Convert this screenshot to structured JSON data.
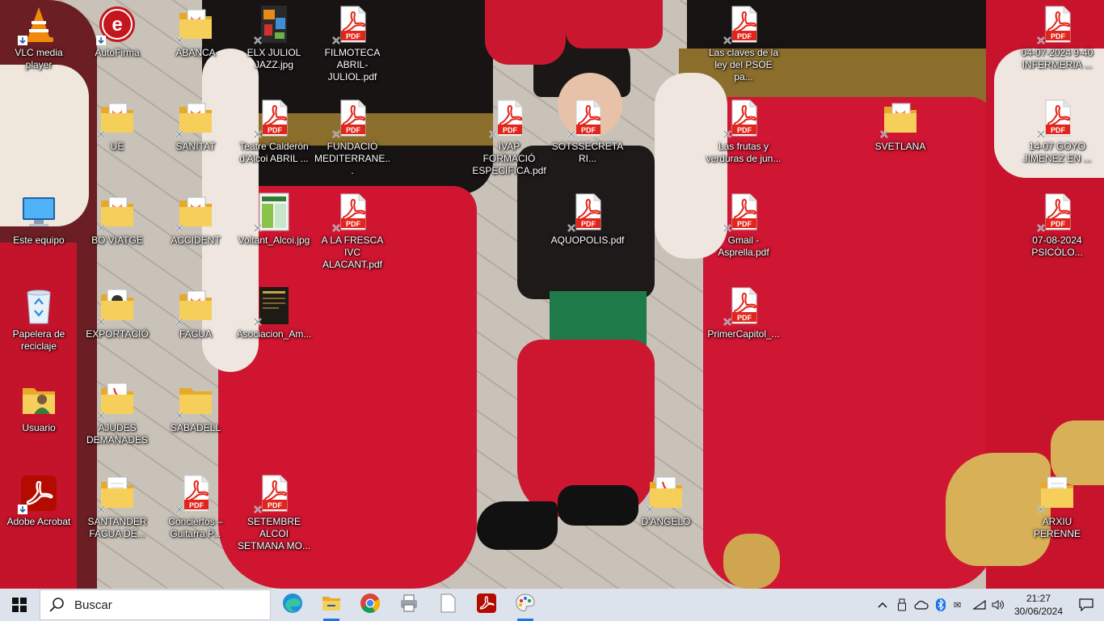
{
  "desktop": {
    "icons": [
      {
        "id": "vlc",
        "label": "VLC media player",
        "type": "vlc",
        "badge": "shortcut"
      },
      {
        "id": "autofirma",
        "label": "AutoFirma",
        "type": "autofirma",
        "badge": "shortcut"
      },
      {
        "id": "abanca",
        "label": "ABANCA",
        "type": "folder-doc",
        "badge": "x"
      },
      {
        "id": "elx",
        "label": "ELX JULIOL JAZZ.jpg",
        "type": "jpg-poster",
        "badge": "x"
      },
      {
        "id": "filmoteca",
        "label": "FILMOTECA ABRIL-JULIOL.pdf",
        "type": "pdf",
        "badge": "x"
      },
      {
        "id": "claves",
        "label": "Las claves de la ley del PSOE pa...",
        "type": "pdf",
        "badge": "x"
      },
      {
        "id": "infermeria",
        "label": "04-07-2024 9-40 INFERMERIA ...",
        "type": "pdf",
        "badge": "x"
      },
      {
        "id": "ue",
        "label": "UE",
        "type": "folder-doc",
        "badge": "x"
      },
      {
        "id": "sanitat",
        "label": "SANITAT",
        "type": "folder-doc",
        "badge": "x"
      },
      {
        "id": "teatre",
        "label": "Teatre Calderón d'Alcoi ABRIL ...",
        "type": "pdf",
        "badge": "x"
      },
      {
        "id": "fundacio",
        "label": "FUNDACIÓ MEDITERRANE...",
        "type": "pdf",
        "badge": "x"
      },
      {
        "id": "ivap",
        "label": "IVAP FORMACIÓ ESPECÍFICA.pdf",
        "type": "pdf",
        "badge": "x"
      },
      {
        "id": "sotssecretari",
        "label": "SOTSSECRETARI...",
        "type": "pdf",
        "badge": "x"
      },
      {
        "id": "frutas",
        "label": "Las frutas y verduras de jun...",
        "type": "pdf",
        "badge": "x"
      },
      {
        "id": "svetlana",
        "label": "SVETLANA",
        "type": "folder-doc",
        "badge": "x"
      },
      {
        "id": "goyo",
        "label": "14-07 GOYO JIMENEZ EN ...",
        "type": "pdf",
        "badge": "x"
      },
      {
        "id": "esteequipo",
        "label": "Este equipo",
        "type": "computer",
        "badge": "none"
      },
      {
        "id": "boviatge",
        "label": "BO VIATGE",
        "type": "folder-doc",
        "badge": "x"
      },
      {
        "id": "accident",
        "label": "ACCIDENT",
        "type": "folder-doc",
        "badge": "x"
      },
      {
        "id": "voltant",
        "label": "Voltant_Alcoi.jpg",
        "type": "jpg-map",
        "badge": "x"
      },
      {
        "id": "fresca",
        "label": "A LA FRESCA IVC ALACANT.pdf",
        "type": "pdf",
        "badge": "x"
      },
      {
        "id": "aquopolis",
        "label": "AQUOPOLIS.pdf",
        "type": "pdf",
        "badge": "x"
      },
      {
        "id": "gmail",
        "label": "Gmail - Asprella.pdf",
        "type": "pdf",
        "badge": "x"
      },
      {
        "id": "psicolo",
        "label": "07-08-2024 PSICÒLO...",
        "type": "pdf",
        "badge": "x"
      },
      {
        "id": "papelera",
        "label": "Papelera de reciclaje",
        "type": "recycle",
        "badge": "none"
      },
      {
        "id": "exportacio",
        "label": "EXPORTACIÓ",
        "type": "folder-media",
        "badge": "x"
      },
      {
        "id": "facua",
        "label": "FACUA",
        "type": "folder-doc",
        "badge": "x"
      },
      {
        "id": "asociacion",
        "label": "Asociacion_Am...",
        "type": "jpg-dark",
        "badge": "x"
      },
      {
        "id": "primercapitol",
        "label": "PrimerCapitol_...",
        "type": "pdf",
        "badge": "x"
      },
      {
        "id": "usuario",
        "label": "Usuario",
        "type": "user-folder",
        "badge": "none"
      },
      {
        "id": "ajudes",
        "label": "AJUDES DEMANADES",
        "type": "folder-pdf",
        "badge": "x"
      },
      {
        "id": "sabadell",
        "label": "SABADELL",
        "type": "folder",
        "badge": "x"
      },
      {
        "id": "acrobat",
        "label": "Adobe Acrobat",
        "type": "acrobat",
        "badge": "shortcut"
      },
      {
        "id": "santander",
        "label": "SANTANDER FACUA DE...",
        "type": "folder-paper",
        "badge": "x"
      },
      {
        "id": "conciertos",
        "label": "Conciertos – Guitarra P...",
        "type": "pdf",
        "badge": "x"
      },
      {
        "id": "setembre",
        "label": "SETEMBRE ALCOI SETMANA MO...",
        "type": "pdf",
        "badge": "x"
      },
      {
        "id": "dangelo",
        "label": "D'ANGELO",
        "type": "folder-pdf",
        "badge": "x"
      },
      {
        "id": "arxiu",
        "label": "ARXIU PERENNE",
        "type": "folder-paper",
        "badge": "x"
      }
    ]
  },
  "taskbar": {
    "search_placeholder": "Buscar",
    "apps": [
      {
        "id": "edge",
        "name": "Microsoft Edge",
        "icon": "edge-icon",
        "active": false
      },
      {
        "id": "explorer",
        "name": "Explorador de archivos",
        "icon": "folder-icon",
        "active": true
      },
      {
        "id": "chrome",
        "name": "Google Chrome",
        "icon": "chrome-icon",
        "active": false
      },
      {
        "id": "printer",
        "name": "Impresora",
        "icon": "printer-icon",
        "active": false
      },
      {
        "id": "notepad",
        "name": "Documento",
        "icon": "document-icon",
        "active": false
      },
      {
        "id": "acrobat",
        "name": "Adobe Acrobat",
        "icon": "acrobat-icon",
        "active": false
      },
      {
        "id": "paint",
        "name": "Paint",
        "icon": "paint-icon",
        "active": true
      }
    ],
    "tray": {
      "time": "21:27",
      "date": "30/06/2024"
    }
  },
  "colors": {
    "taskbar_bg": "#dde3ec",
    "pdf_red": "#e1251b",
    "folder_yellow": "#f3c64a",
    "accent": "#1a73e8"
  }
}
